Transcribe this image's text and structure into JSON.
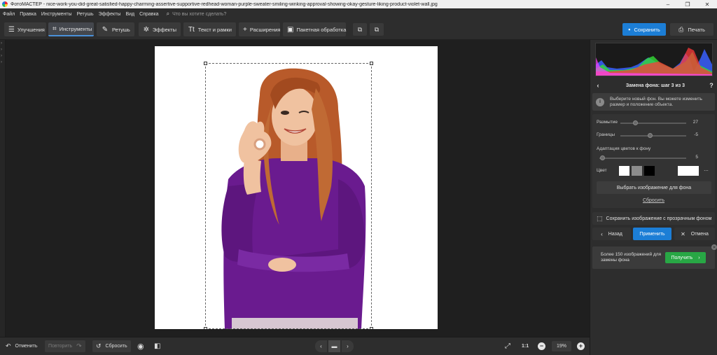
{
  "titlebar": {
    "title": "ФотоМАСТЕР - nice-work-you-did-great-satisfied-happy-charming-assertive-supportive-redhead-woman-purple-sweater-smiling-winking-approval-showing-okay-gesture-liking-product-violet-wall.jpg",
    "minimize": "–",
    "restore": "❐",
    "close": "✕"
  },
  "menu": {
    "items": [
      "Файл",
      "Правка",
      "Инструменты",
      "Ретушь",
      "Эффекты",
      "Вид",
      "Справка"
    ],
    "search_placeholder": "Что вы хотите сделать?"
  },
  "toolbar": {
    "enhance": "Улучшения",
    "tools": "Инструменты",
    "retouch": "Ретушь",
    "effects": "Эффекты",
    "text_frames": "Текст и рамки",
    "extensions": "Расширения",
    "batch": "Пакетная обработка",
    "save": "Сохранить",
    "print": "Печать"
  },
  "panel": {
    "title": "Замена фона: шаг 3 из 3",
    "help": "?",
    "hint": "Выберите новый фон. Вы можете изменить размер и положение объекта.",
    "sliders": [
      {
        "label": "Размытие",
        "value": "27",
        "fraction": 0.22
      },
      {
        "label": "Границы",
        "value": "-5",
        "fraction": 0.45
      }
    ],
    "adapt_label": "Адаптация цветов к фону",
    "adapt_value": "5",
    "adapt_fraction": 0.03,
    "color_label": "Цвет",
    "swatches": [
      "#ffffff",
      "#8c8c8c",
      "#000000"
    ],
    "current_color": "#ffffff",
    "more": "...",
    "pick_image": "Выбрать изображение для фона",
    "reset": "Сбросить",
    "save_transparent": "Сохранить изображение с прозрачным фоном",
    "back": "Назад",
    "apply": "Применить",
    "cancel": "Отмена",
    "promo_text": "Более 150 изображений для замены фона",
    "promo_button": "Получить"
  },
  "bottombar": {
    "undo": "Отменить",
    "redo": "Повторить",
    "reset": "Сбросить",
    "one_to_one": "1:1",
    "zoom": "19%"
  },
  "colors": {
    "accent": "#1c7ed6",
    "promo_green": "#28a745"
  }
}
